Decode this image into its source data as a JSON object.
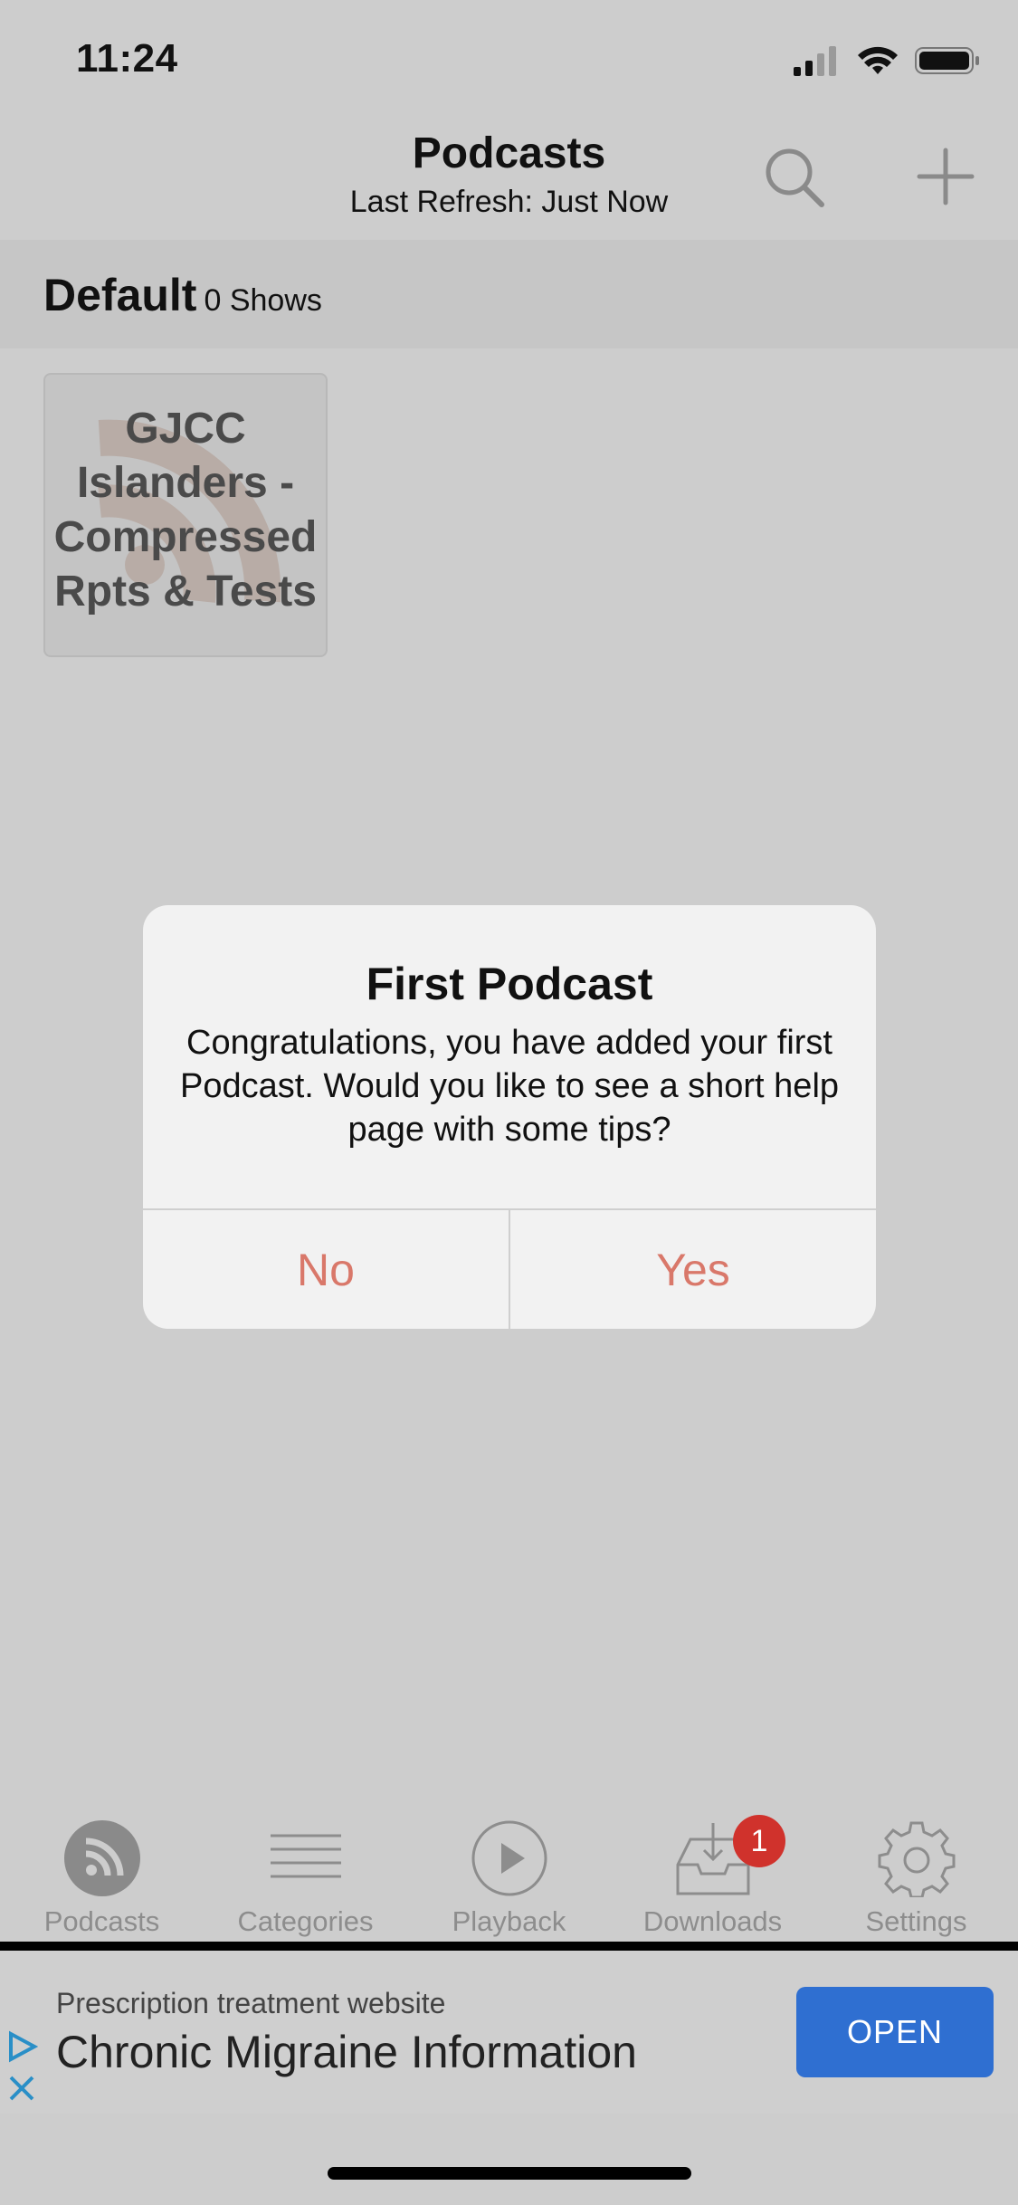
{
  "status": {
    "time": "11:24"
  },
  "nav": {
    "title": "Podcasts",
    "subtitle": "Last Refresh: Just Now",
    "search_icon": "search-icon",
    "add_icon": "plus-icon"
  },
  "section": {
    "name": "Default",
    "count": "0 Shows"
  },
  "podcasts": [
    {
      "title_lines": [
        "GJCC",
        "Islanders -",
        "Compressed",
        "Rpts & Tests"
      ]
    }
  ],
  "dialog": {
    "title": "First Podcast",
    "message": "Congratulations, you have added your first Podcast. Would you like to see a short help page with some tips?",
    "no_label": "No",
    "yes_label": "Yes",
    "button_color": "#d9786a"
  },
  "tabs": [
    {
      "label": "Podcasts",
      "icon": "rss-icon",
      "active": true
    },
    {
      "label": "Categories",
      "icon": "list-icon"
    },
    {
      "label": "Playback",
      "icon": "play-icon"
    },
    {
      "label": "Downloads",
      "icon": "inbox-download-icon",
      "badge": "1"
    },
    {
      "label": "Settings",
      "icon": "gear-icon"
    }
  ],
  "ad": {
    "small_text": "Prescription treatment website",
    "headline": "Chronic Migraine Information",
    "cta": "OPEN",
    "cta_color": "#2f6fd1"
  }
}
